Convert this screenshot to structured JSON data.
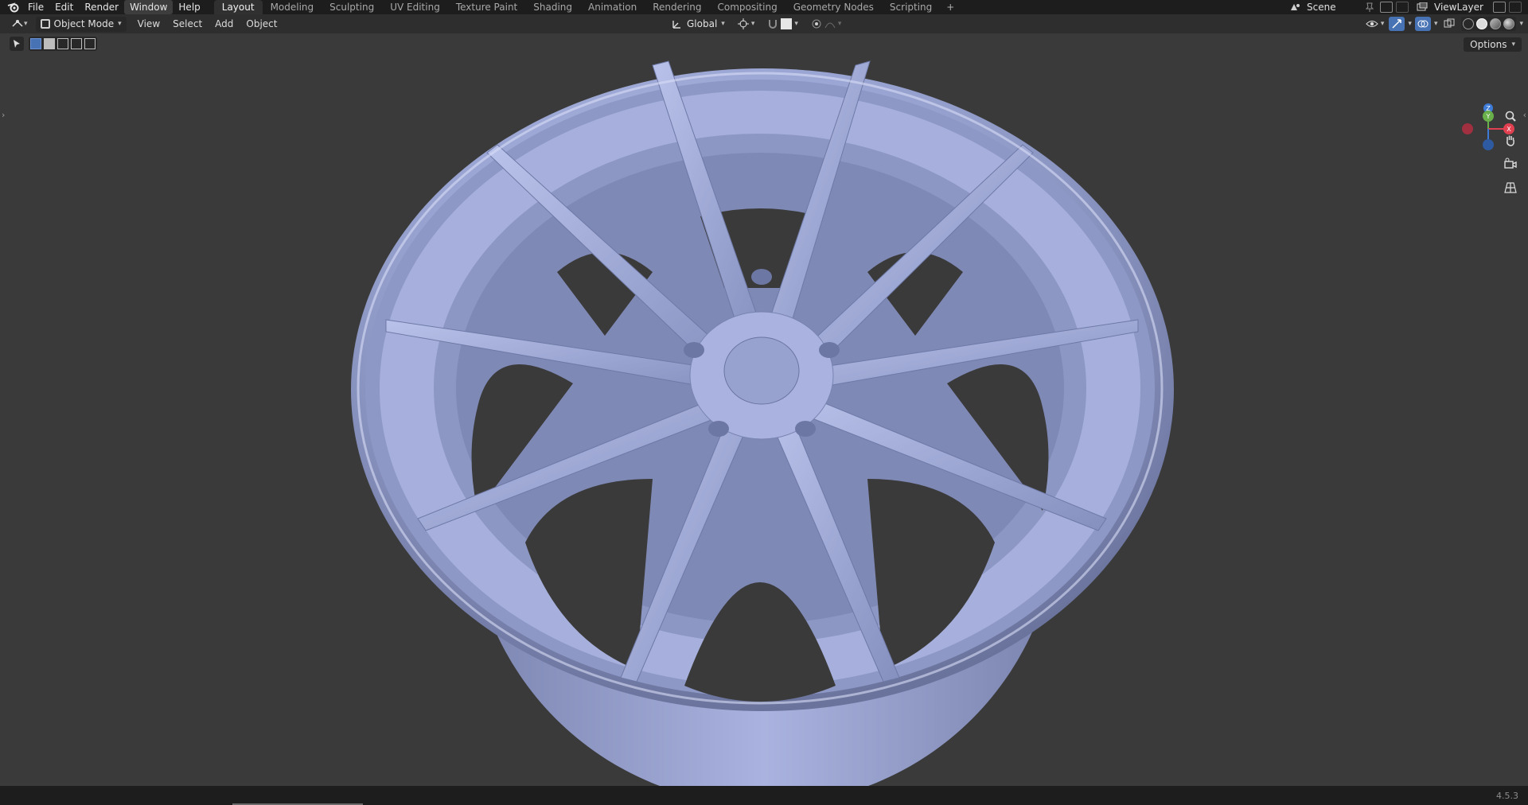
{
  "app": {
    "menus": [
      "File",
      "Edit",
      "Render",
      "Window",
      "Help"
    ],
    "active_menu": "Window",
    "workspaces": [
      "Layout",
      "Modeling",
      "Sculpting",
      "UV Editing",
      "Texture Paint",
      "Shading",
      "Animation",
      "Rendering",
      "Compositing",
      "Geometry Nodes",
      "Scripting"
    ],
    "active_workspace": "Layout",
    "add_workspace": "+",
    "scene": "Scene",
    "view_layer": "ViewLayer",
    "version": "4.5.3"
  },
  "header": {
    "mode": "Object Mode",
    "menus": [
      "View",
      "Select",
      "Add",
      "Object"
    ],
    "orientation": "Global"
  },
  "toolbar": {
    "options_label": "Options"
  },
  "gizmo": {
    "axes": [
      "Z",
      "Y",
      "X"
    ],
    "colors": {
      "x": "#e04050",
      "y": "#6ab04a",
      "z": "#3d7bd6"
    }
  },
  "colors": {
    "viewport_bg": "#3a3a3a",
    "wheel": "#8c97c4",
    "accent": "#4772b3"
  },
  "icons": {
    "nav": [
      "zoom-icon",
      "pan-hand-icon",
      "camera-icon",
      "grid-perspective-icon"
    ]
  }
}
